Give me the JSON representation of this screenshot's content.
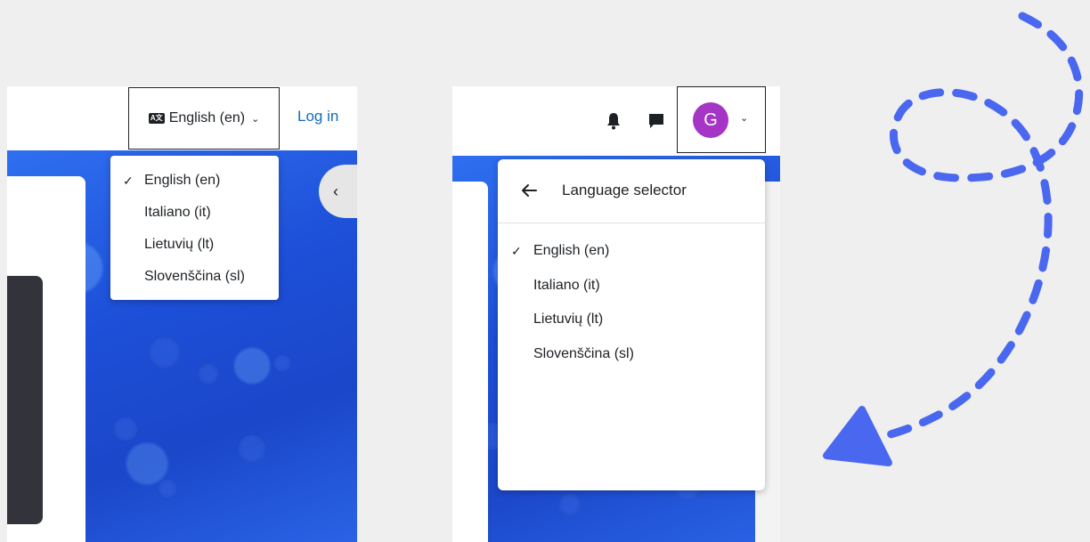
{
  "left": {
    "language_button": {
      "label": "English (en)",
      "icon_text": "A文"
    },
    "login_label": "Log in",
    "menu": [
      {
        "label": "English (en)",
        "selected": true
      },
      {
        "label": "Italiano (it)",
        "selected": false
      },
      {
        "label": "Lietuvių (lt)",
        "selected": false
      },
      {
        "label": "Slovenščina (sl)",
        "selected": false
      }
    ],
    "check_glyph": "✓",
    "collapse_glyph": "‹"
  },
  "right": {
    "avatar_initial": "G",
    "submenu_title": "Language selector",
    "menu": [
      {
        "label": "English (en)",
        "selected": true
      },
      {
        "label": "Italiano (it)",
        "selected": false
      },
      {
        "label": "Lietuvių (lt)",
        "selected": false
      },
      {
        "label": "Slovenščina (sl)",
        "selected": false
      }
    ],
    "check_glyph": "✓"
  },
  "colors": {
    "accent_blue": "#0f6cbf",
    "avatar_purple": "#a535c4",
    "arrow_blue": "#4a67f0"
  },
  "icons": [
    "language-icon",
    "chevron-down-icon",
    "check-icon",
    "chevron-left-icon",
    "bell-icon",
    "chat-icon",
    "arrow-left-icon"
  ]
}
